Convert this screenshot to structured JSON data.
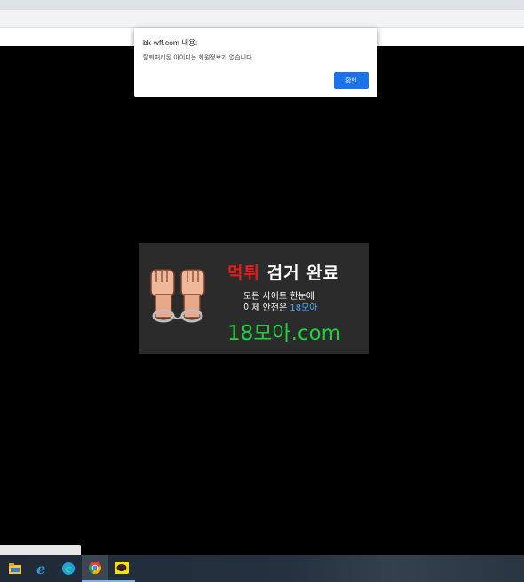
{
  "dialog": {
    "title": "bk-wff.com 내용:",
    "message": "탈퇴처리된 아이디는 회원정보가 없습니다.",
    "ok_label": "확인"
  },
  "banner": {
    "title_red": "먹튀",
    "title_white": " 검거 완료",
    "line1": "모든 사이트 한눈에",
    "line2_prefix": "이제 안전은 ",
    "line2_highlight": "18모아",
    "domain": "18모아.com",
    "colors": {
      "title_red": "#e81b1b",
      "highlight_blue": "#4fa7ff",
      "domain_green": "#1fd040",
      "background": "#2b2b2b"
    }
  },
  "taskbar": {
    "icons": [
      {
        "name": "file-explorer-icon"
      },
      {
        "name": "internet-explorer-icon"
      },
      {
        "name": "edge-icon"
      },
      {
        "name": "chrome-icon"
      },
      {
        "name": "kakaotalk-icon"
      }
    ]
  }
}
